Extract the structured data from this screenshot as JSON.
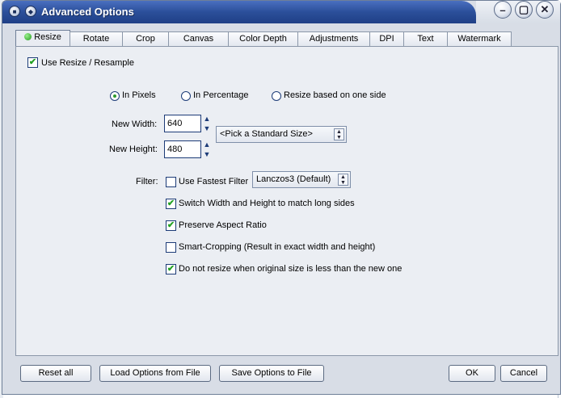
{
  "window": {
    "title": "Advanced Options",
    "controls": [
      "minimize-icon",
      "maximize-icon",
      "close-icon"
    ]
  },
  "tabs": [
    {
      "label": "Resize",
      "active": true
    },
    {
      "label": "Rotate"
    },
    {
      "label": "Crop"
    },
    {
      "label": "Canvas"
    },
    {
      "label": "Color Depth"
    },
    {
      "label": "Adjustments"
    },
    {
      "label": "DPI"
    },
    {
      "label": "Text"
    },
    {
      "label": "Watermark"
    }
  ],
  "resize": {
    "use_resize": {
      "label": "Use Resize / Resample",
      "checked": true
    },
    "mode_radios": [
      {
        "label": "In Pixels",
        "checked": true
      },
      {
        "label": "In Percentage",
        "checked": false
      },
      {
        "label": "Resize based on one side",
        "checked": false
      }
    ],
    "new_width_label": "New Width:",
    "new_width_value": "640",
    "new_height_label": "New Height:",
    "new_height_value": "480",
    "standard_size": "<Pick a Standard Size>",
    "filter_label": "Filter:",
    "fastest_filter": {
      "label": "Use Fastest Filter",
      "checked": false
    },
    "filter_value": "Lanczos3 (Default)",
    "options": [
      {
        "label": "Switch Width and Height to match long sides",
        "checked": true
      },
      {
        "label": "Preserve Aspect Ratio",
        "checked": true
      },
      {
        "label": "Smart-Cropping (Result in exact width and height)",
        "checked": false
      },
      {
        "label": "Do not resize when original size is less than the new one",
        "checked": true
      }
    ]
  },
  "footer": {
    "reset_all": "Reset all",
    "load_options": "Load Options from File",
    "save_options": "Save Options to File",
    "ok": "OK",
    "cancel": "Cancel"
  },
  "colors": {
    "title_bar": "#2b4f9a",
    "window_bg": "#d8dde6",
    "panel_bg": "#ebeef3",
    "check_green": "#21a121"
  }
}
